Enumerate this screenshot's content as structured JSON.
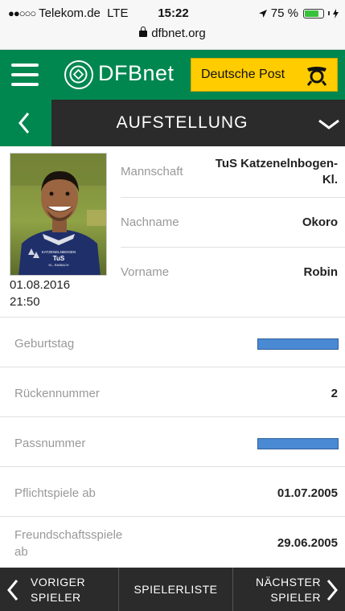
{
  "status_bar": {
    "carrier": "Telekom.de",
    "network": "LTE",
    "time": "15:22",
    "battery": "75 %",
    "battery_level": 0.75,
    "url": "dfbnet.org"
  },
  "header": {
    "logo_text": "DFBnet",
    "sponsor_text": "Deutsche Post",
    "brand_color": "#008750",
    "sponsor_color": "#ffcc00"
  },
  "title_bar": {
    "title": "AUFSTELLUNG"
  },
  "profile": {
    "photo_timestamp_date": "01.08.2016",
    "photo_timestamp_time": "21:50",
    "fields": [
      {
        "label": "Mannschaft",
        "value_line1": "TuS Katzenelnbogen-",
        "value_line2": "Kl."
      },
      {
        "label": "Nachname",
        "value": "Okoro"
      },
      {
        "label": "Vorname",
        "value": "Robin"
      }
    ],
    "shirt_text_1": "KATZENELNBOGEN",
    "shirt_text_2": "TuS",
    "shirt_text_3": "KL.-RAIBACH"
  },
  "details": [
    {
      "label": "Geburtstag",
      "value": "",
      "redacted": true
    },
    {
      "label": "Rückennummer",
      "value": "2",
      "redacted": false
    },
    {
      "label": "Passnummer",
      "value": "",
      "redacted": true
    },
    {
      "label": "Pflichtspiele ab",
      "value": "01.07.2005",
      "redacted": false
    },
    {
      "label_line1": "Freundschaftsspiele",
      "label_line2": "ab",
      "value": "29.06.2005",
      "redacted": false
    }
  ],
  "bottom_nav": {
    "prev_line1": "VORIGER",
    "prev_line2": "SPIELER",
    "list": "SPIELERLISTE",
    "next_line1": "NÄCHSTER",
    "next_line2": "SPIELER"
  }
}
